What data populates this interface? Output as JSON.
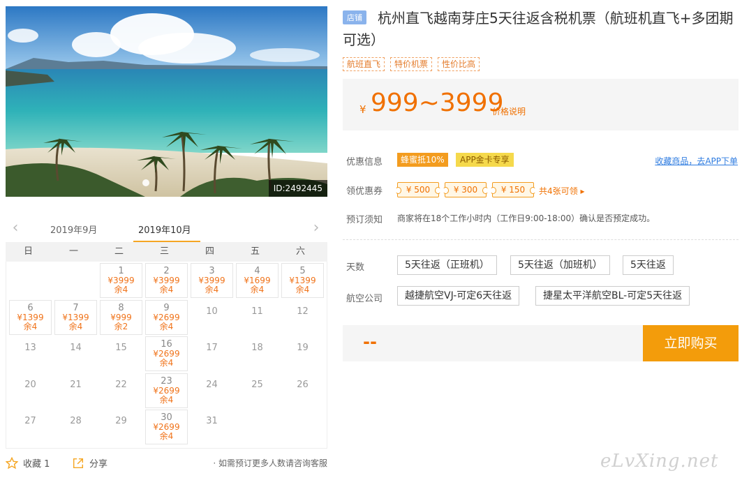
{
  "photo": {
    "id_label": "ID:2492445"
  },
  "calendar": {
    "prev_month": "2019年9月",
    "current_month": "2019年10月",
    "weekdays": [
      "日",
      "一",
      "二",
      "三",
      "四",
      "五",
      "六"
    ],
    "days": [
      {
        "day": "1",
        "price": "¥3999",
        "remain": "余4"
      },
      {
        "day": "2",
        "price": "¥3999",
        "remain": "余4"
      },
      {
        "day": "3",
        "price": "¥3999",
        "remain": "余4"
      },
      {
        "day": "4",
        "price": "¥1699",
        "remain": "余4"
      },
      {
        "day": "5",
        "price": "¥1399",
        "remain": "余4"
      },
      {
        "day": "6",
        "price": "¥1399",
        "remain": "余4"
      },
      {
        "day": "7",
        "price": "¥1399",
        "remain": "余4"
      },
      {
        "day": "8",
        "price": "¥999",
        "remain": "余2"
      },
      {
        "day": "9",
        "price": "¥2699",
        "remain": "余4"
      },
      {
        "day": "10"
      },
      {
        "day": "11"
      },
      {
        "day": "12"
      },
      {
        "day": "13"
      },
      {
        "day": "14"
      },
      {
        "day": "15"
      },
      {
        "day": "16",
        "price": "¥2699",
        "remain": "余4"
      },
      {
        "day": "17"
      },
      {
        "day": "18"
      },
      {
        "day": "19"
      },
      {
        "day": "20"
      },
      {
        "day": "21"
      },
      {
        "day": "22"
      },
      {
        "day": "23",
        "price": "¥2699",
        "remain": "余4"
      },
      {
        "day": "24"
      },
      {
        "day": "25"
      },
      {
        "day": "26"
      },
      {
        "day": "27"
      },
      {
        "day": "28"
      },
      {
        "day": "29"
      },
      {
        "day": "30",
        "price": "¥2699",
        "remain": "余4"
      },
      {
        "day": "31"
      }
    ],
    "first_weekday": 2
  },
  "actions": {
    "favorite_label": "收藏 1",
    "share_label": "分享",
    "note": "· 如需预订更多人数请咨询客服"
  },
  "product": {
    "shop_tag": "店铺",
    "title": "杭州直飞越南芽庄5天往返含税机票（航班机直飞+多团期可选）",
    "tags": [
      "航班直飞",
      "特价机票",
      "性价比高"
    ],
    "price_symbol": "¥",
    "price_range": "999~3999",
    "price_explain": "价格说明"
  },
  "info": {
    "discount_label": "优惠信息",
    "discount_badge1": "蜂蜜抵10%",
    "discount_badge2": "APP金卡专享",
    "fav_link": "收藏商品，去APP下单",
    "coupon_label": "领优惠券",
    "coupons": [
      "¥ 500",
      "¥ 300",
      "¥ 150"
    ],
    "more_coupons": "共4张可领 ▸",
    "notice_label": "预订须知",
    "notice_text": "商家将在18个工作小时内（工作日9:00-18:00）确认是否预定成功。"
  },
  "options": {
    "days_label": "天数",
    "days": [
      "5天往返（正班机）",
      "5天往返（加班机）",
      "5天往返"
    ],
    "airline_label": "航空公司",
    "airlines": [
      "越捷航空VJ-可定6天往返",
      "捷星太平洋航空BL-可定5天往返"
    ]
  },
  "buy": {
    "total": "--",
    "button": "立即购买"
  },
  "watermark": "eLvXing.net",
  "colors": {
    "accent": "#f39c0b",
    "price": "#f07000",
    "link": "#2d7be0"
  }
}
